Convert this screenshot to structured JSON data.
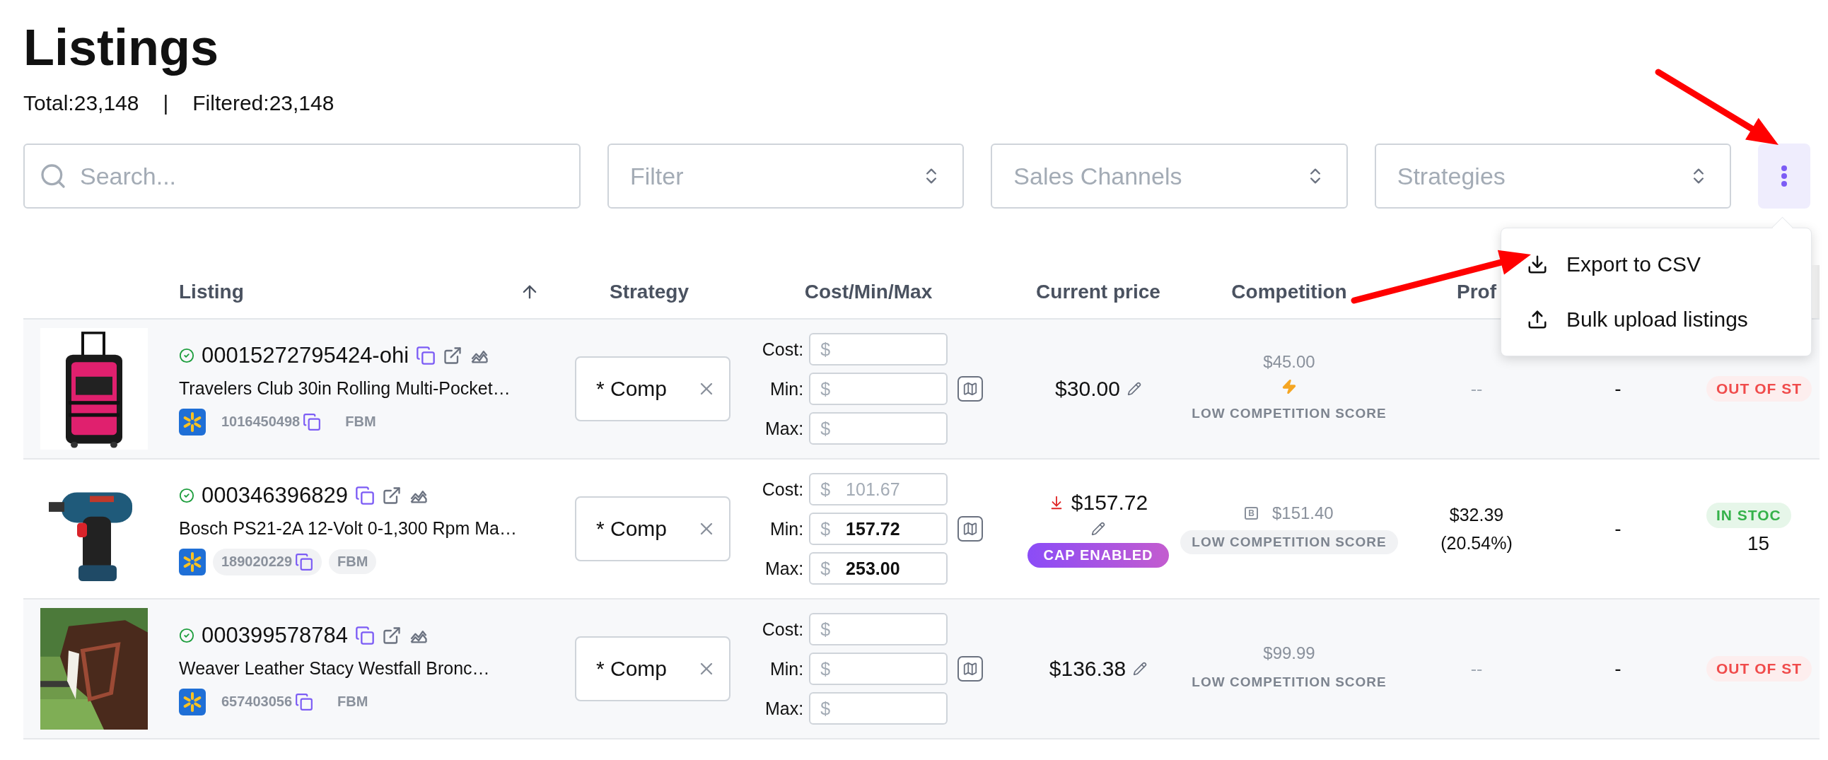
{
  "title": "Listings",
  "summary": {
    "total": "Total:23,148",
    "separator": "|",
    "filtered": "Filtered:23,148"
  },
  "toolbar": {
    "search": {
      "placeholder": "Search..."
    },
    "selects": [
      {
        "placeholder": "Filter"
      },
      {
        "placeholder": "Sales Channels"
      },
      {
        "placeholder": "Strategies"
      }
    ],
    "menu_button": {
      "expanded": true
    }
  },
  "menu": [
    {
      "label": "Export to CSV",
      "kind": "download"
    },
    {
      "label": "Bulk upload listings",
      "kind": "upload"
    }
  ],
  "columns": [
    {
      "label": "Listing",
      "sorted": true
    },
    {
      "label": "Strategy",
      "sorted": false
    },
    {
      "label": "Cost/Min/Max",
      "sorted": false
    },
    {
      "label": "Current price",
      "sorted": false
    },
    {
      "label": "Competition",
      "sorted": false
    },
    {
      "label": "Prof",
      "sorted": false
    }
  ],
  "rows": [
    {
      "hovered": false,
      "verified": true,
      "sku": "00015272795424-ohi",
      "name": "Travelers Club 30in Rolling Multi-Pocket…",
      "item_id": "1016450498",
      "fulfillment": "FBM",
      "strategy": "* Comp",
      "fields": [
        {
          "label": "Cost:",
          "prefix": "$"
        },
        {
          "label": "Min:",
          "prefix": "$"
        },
        {
          "label": "Max:",
          "prefix": "$"
        }
      ],
      "price": "$30.00",
      "price_drop": false,
      "competition": {
        "price": "$45.00",
        "boosted": true,
        "label": "LOW COMPETITION SCORE"
      },
      "profit": {
        "lines": [
          "--"
        ],
        "muted": true
      },
      "column_7": "-",
      "stock": {
        "label": "OUT OF ST",
        "in_stock": false
      }
    },
    {
      "hovered": true,
      "verified": true,
      "sku": "000346396829",
      "name": "Bosch PS21-2A 12-Volt 0-1,300 Rpm Ma…",
      "item_id": "189020229",
      "fulfillment": "FBM",
      "strategy": "* Comp",
      "fields": [
        {
          "label": "Cost:",
          "prefix": "$",
          "placeholder": "101.67"
        },
        {
          "label": "Min:",
          "prefix": "$",
          "value": "157.72"
        },
        {
          "label": "Max:",
          "prefix": "$",
          "value": "253.00"
        }
      ],
      "price": "$157.72",
      "price_drop": true,
      "cap": "CAP ENABLED",
      "competition": {
        "price": "$151.40",
        "boosted": false,
        "buy_box": "B",
        "label": "LOW COMPETITION SCORE"
      },
      "profit": {
        "lines": [
          "$32.39",
          "(20.54%)"
        ],
        "muted": false
      },
      "column_7": "-",
      "stock": {
        "label": "IN STOC",
        "in_stock": true,
        "quantity": "15"
      }
    },
    {
      "hovered": false,
      "verified": true,
      "sku": "000399578784",
      "name": "Weaver Leather Stacy Westfall Bronc…",
      "item_id": "657403056",
      "fulfillment": "FBM",
      "strategy": "* Comp",
      "fields": [
        {
          "label": "Cost:",
          "prefix": "$"
        },
        {
          "label": "Min:",
          "prefix": "$"
        },
        {
          "label": "Max:",
          "prefix": "$"
        }
      ],
      "price": "$136.38",
      "price_drop": false,
      "competition": {
        "price": "$99.99",
        "boosted": false,
        "label": "LOW COMPETITION SCORE"
      },
      "profit": {
        "lines": [
          "--"
        ],
        "muted": true
      },
      "column_7": "-",
      "stock": {
        "label": "OUT OF ST",
        "in_stock": false
      }
    }
  ]
}
